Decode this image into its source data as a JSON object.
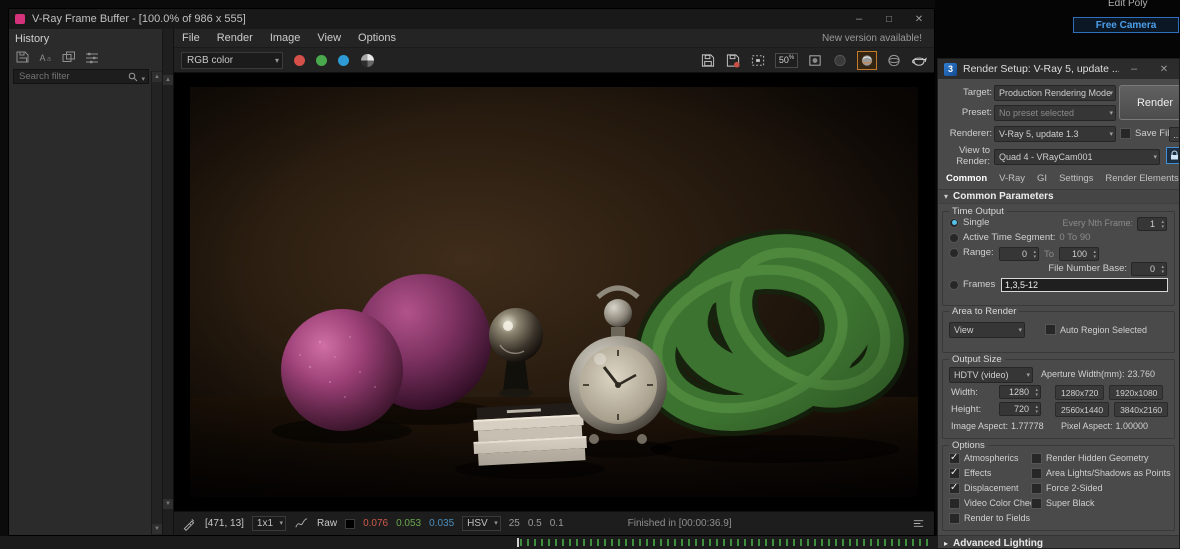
{
  "vfb": {
    "title": "V-Ray Frame Buffer - [100.0% of 986 x 555]",
    "menu": [
      "File",
      "Render",
      "Image",
      "View",
      "Options"
    ],
    "new_version": "New version available!",
    "channel": "RGB color",
    "zoom_value": "50",
    "zoom_unit": "%",
    "history": {
      "title": "History",
      "search_placeholder": "Search filter"
    },
    "status": {
      "coords": "[471, 13]",
      "sample": "1x1",
      "raw": "Raw",
      "r": "0.076",
      "g": "0.053",
      "b": "0.035",
      "hsv": "HSV",
      "h": "25",
      "s": "0.5",
      "v": "0.1",
      "finished": "Finished in [00:00:36.9]"
    }
  },
  "background": {
    "edit_poly": "Edit Poly",
    "free_camera": "Free Camera"
  },
  "render_setup": {
    "title": "Render Setup: V-Ray 5, update ...",
    "target_label": "Target:",
    "target_value": "Production Rendering Mode",
    "render_button": "Render",
    "preset_label": "Preset:",
    "preset_value": "No preset selected",
    "renderer_label": "Renderer:",
    "renderer_value": "V-Ray 5, update 1.3",
    "save_file_label": "Save File",
    "browse_label": "...",
    "view_label_line1": "View to",
    "view_label_line2": "Render:",
    "view_value": "Quad 4 - VRayCam001",
    "tabs": [
      "Common",
      "V-Ray",
      "GI",
      "Settings",
      "Render Elements"
    ],
    "rollout_title": "Common Parameters",
    "time_output": {
      "group_title": "Time Output",
      "single_label": "Single",
      "every_nth_label": "Every Nth Frame:",
      "every_nth_value": "1",
      "active_segment_label": "Active Time Segment:",
      "active_segment_value": "0 To 90",
      "range_label": "Range:",
      "range_from": "0",
      "range_to_word": "To",
      "range_to": "100",
      "file_number_base_label": "File Number Base:",
      "file_number_base_value": "0",
      "frames_label": "Frames",
      "frames_value": "1,3,5-12"
    },
    "area_to_render": {
      "group_title": "Area to Render",
      "mode": "View",
      "auto_region_label": "Auto Region Selected"
    },
    "output_size": {
      "group_title": "Output Size",
      "preset": "HDTV (video)",
      "aperture_label": "Aperture Width(mm):",
      "aperture_value": "23.760",
      "width_label": "Width:",
      "width_value": "1280",
      "height_label": "Height:",
      "height_value": "720",
      "presets": [
        "1280x720",
        "1920x1080",
        "2560x1440",
        "3840x2160"
      ],
      "image_aspect_label": "Image Aspect:",
      "image_aspect_value": "1.77778",
      "pixel_aspect_label": "Pixel Aspect:",
      "pixel_aspect_value": "1.00000"
    },
    "options": {
      "group_title": "Options",
      "left": [
        {
          "label": "Atmospherics",
          "checked": true
        },
        {
          "label": "Effects",
          "checked": true
        },
        {
          "label": "Displacement",
          "checked": true
        },
        {
          "label": "Video Color Check",
          "checked": false
        },
        {
          "label": "Render to Fields",
          "checked": false
        }
      ],
      "right": [
        {
          "label": "Render Hidden Geometry",
          "checked": false
        },
        {
          "label": "Area Lights/Shadows as Points",
          "checked": false
        },
        {
          "label": "Force 2-Sided",
          "checked": false
        },
        {
          "label": "Super Black",
          "checked": false
        }
      ]
    },
    "advanced_lighting_title": "Advanced Lighting"
  },
  "colors": {
    "accent_blue": "#3f8fd2",
    "vray_pink": "#d4327a",
    "tick_green": "#3f8f3f"
  }
}
